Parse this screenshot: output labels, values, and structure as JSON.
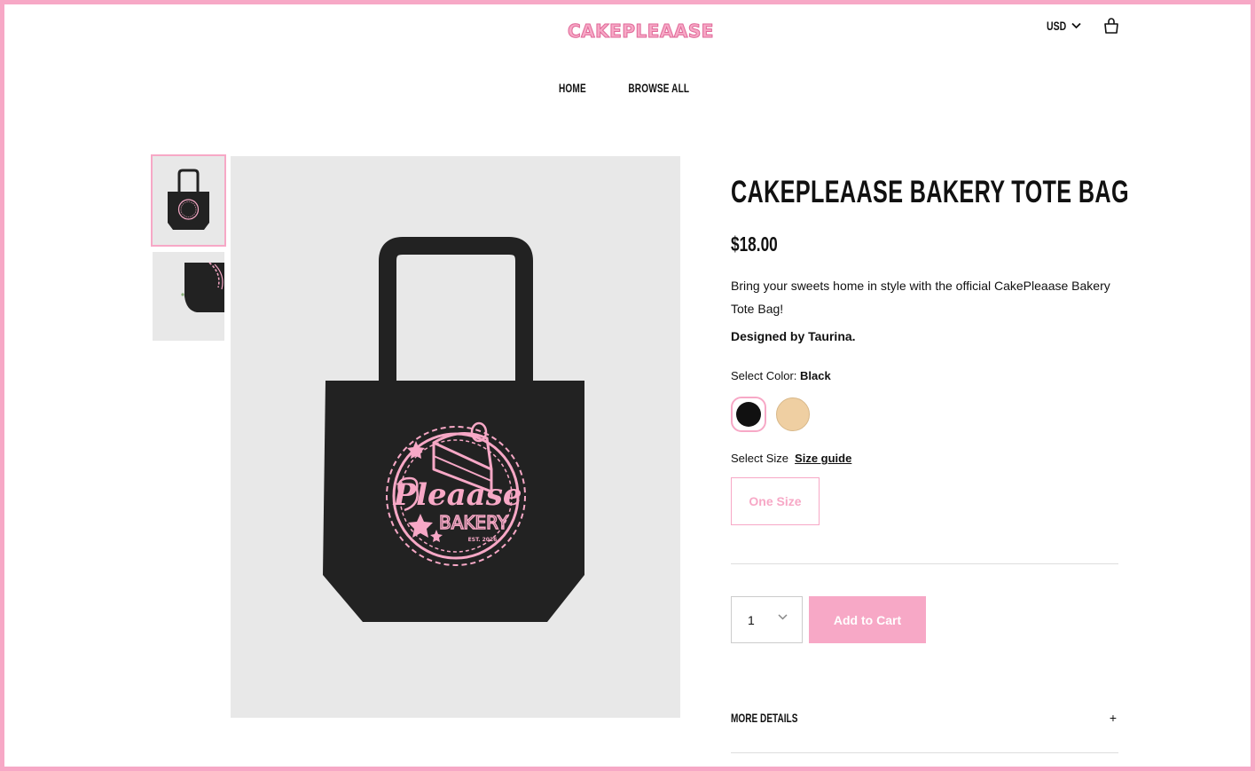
{
  "header": {
    "logo_text": "CAKEPLEAASE",
    "currency": "USD",
    "icons": {
      "currency_chevron": "chevron-down-icon",
      "cart": "shopping-bag-icon"
    }
  },
  "nav": {
    "home": "HOME",
    "browse_all": "BROWSE ALL"
  },
  "product": {
    "title": "CAKEPLEAASE BAKERY TOTE BAG",
    "price": "$18.00",
    "description": "Bring your sweets home in style with the official CakePleaase Bakery Tote Bag!",
    "designed_by": "Designed by Taurina.",
    "artwork_text": "Pleaase",
    "artwork_subtext": "BAKERY",
    "artwork_est": "EST. 2026",
    "color": {
      "label": "Select Color:",
      "selected": "Black",
      "options": [
        {
          "name": "Black",
          "hex": "#111111"
        },
        {
          "name": "Tan",
          "hex": "#efcfa2"
        }
      ]
    },
    "size": {
      "label": "Select Size",
      "guide_label": "Size guide",
      "options": [
        "One Size"
      ]
    },
    "quantity": "1",
    "add_to_cart": "Add to Cart",
    "more_details": "MORE DETAILS",
    "more_details_toggle": "+"
  },
  "colors": {
    "accent_pink": "#f7a8c6",
    "image_bg": "#e8e8e8",
    "bag": "#222222"
  }
}
